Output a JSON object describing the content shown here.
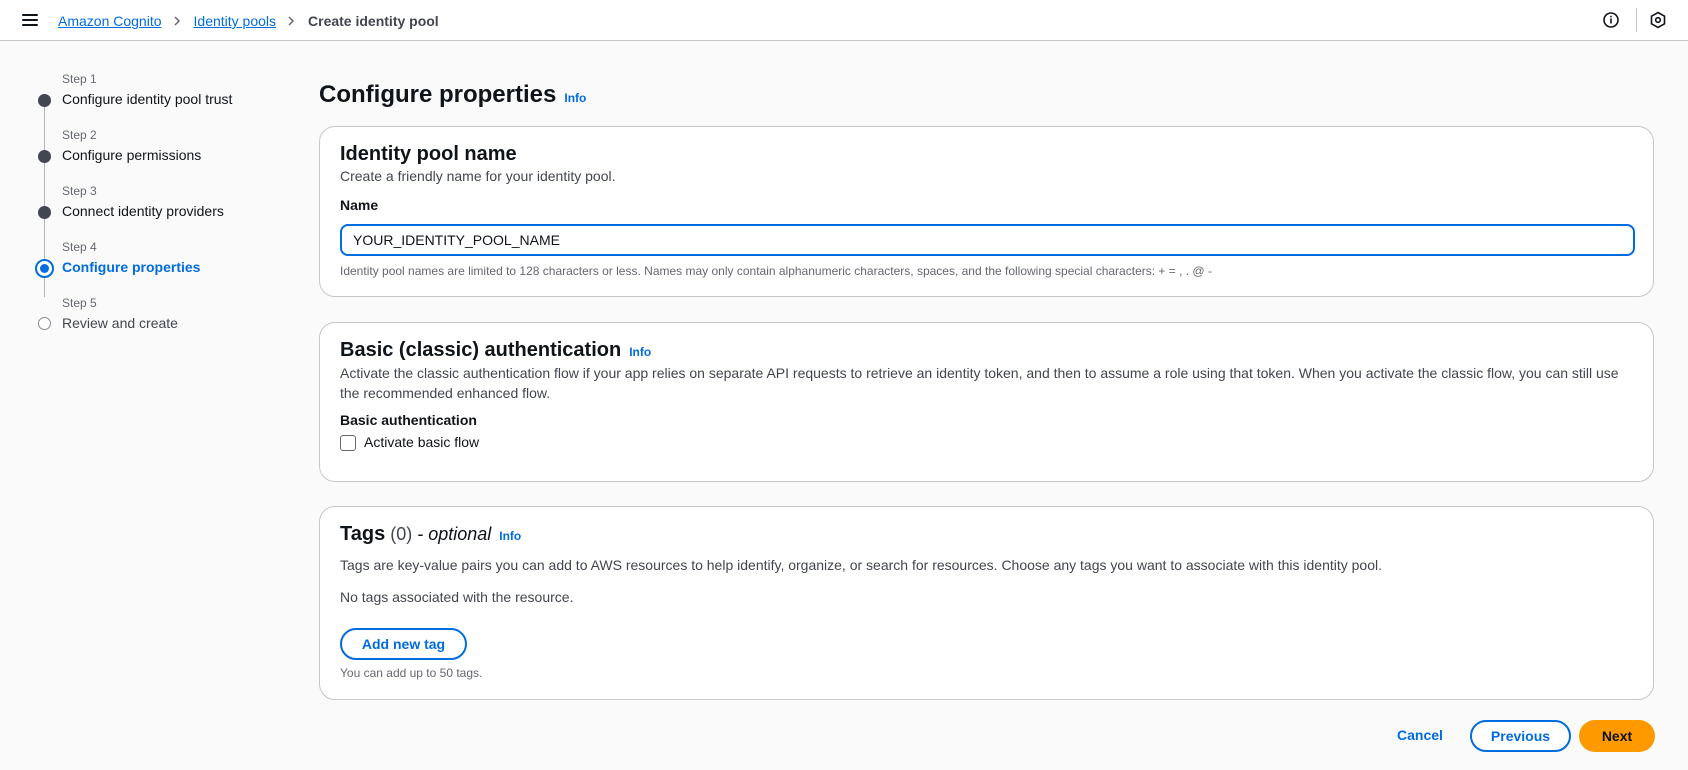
{
  "breadcrumbs": [
    {
      "label": "Amazon Cognito"
    },
    {
      "label": "Identity pools"
    },
    {
      "label": "Create identity pool"
    }
  ],
  "icons": {
    "menu": "hamburger-menu-icon",
    "separator": "chevron-right-icon",
    "info": "info-circle-icon",
    "notifications": "hexagon-settings-icon"
  },
  "steps": [
    {
      "label": "Step 1",
      "title": "Configure identity pool trust",
      "state": "complete"
    },
    {
      "label": "Step 2",
      "title": "Configure permissions",
      "state": "complete"
    },
    {
      "label": "Step 3",
      "title": "Connect identity providers",
      "state": "complete"
    },
    {
      "label": "Step 4",
      "title": "Configure properties",
      "state": "active"
    },
    {
      "label": "Step 5",
      "title": "Review and create",
      "state": "pending"
    }
  ],
  "page": {
    "title": "Configure properties",
    "info": "Info"
  },
  "identity_pool_name": {
    "title": "Identity pool name",
    "description": "Create a friendly name for your identity pool.",
    "field_label": "Name",
    "value": "YOUR_IDENTITY_POOL_NAME",
    "hint": "Identity pool names are limited to 128 characters or less. Names may only contain alphanumeric characters, spaces, and the following special characters: + = , . @ -"
  },
  "basic_auth": {
    "title": "Basic (classic) authentication",
    "info": "Info",
    "description": "Activate the classic authentication flow if your app relies on separate API requests to retrieve an identity token, and then to assume a role using that token. When you activate the classic flow, you can still use the recommended enhanced flow.",
    "field_label": "Basic authentication",
    "checkbox_label": "Activate basic flow",
    "checked": false
  },
  "tags": {
    "title": "Tags",
    "count": "(0)",
    "optional": "- optional",
    "info": "Info",
    "description": "Tags are key-value pairs you can add to AWS resources to help identify, organize, or search for resources. Choose any tags you want to associate with this identity pool.",
    "empty": "No tags associated with the resource.",
    "add_button": "Add new tag",
    "limit_hint": "You can add up to 50 tags."
  },
  "footer": {
    "cancel": "Cancel",
    "previous": "Previous",
    "next": "Next"
  },
  "colors": {
    "link": "#006ce0",
    "primary_button": "#ff9900",
    "page_background": "#fafafa",
    "panel_border": "#c6c6cd"
  }
}
